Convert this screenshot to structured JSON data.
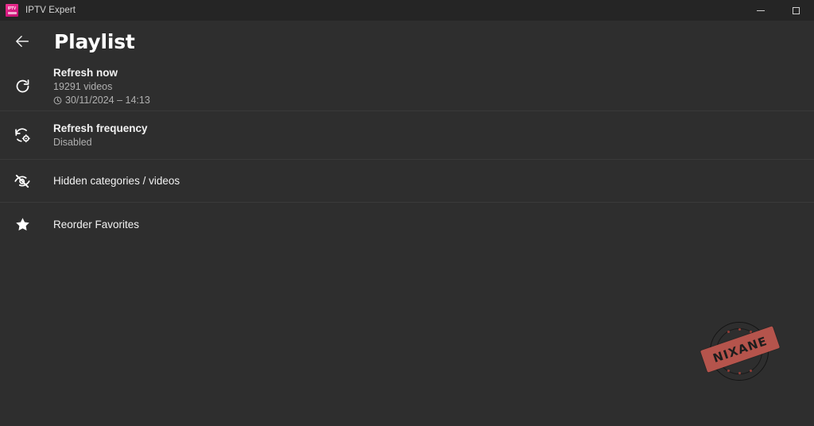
{
  "window": {
    "app_title": "IPTV Expert",
    "app_icon": "iptv-app-icon",
    "icon_glyph": "IPTV",
    "controls": [
      {
        "name": "minimize-button",
        "label": "Minimize"
      },
      {
        "name": "maximize-button",
        "label": "Maximize"
      }
    ]
  },
  "header": {
    "back_icon": "back-arrow-icon",
    "title": "Playlist"
  },
  "list": [
    {
      "icon": "refresh-icon",
      "title": "Refresh now",
      "subtitle": "19291 videos",
      "meta_icon": "clock-icon",
      "meta": "30/11/2024 – 14:13"
    },
    {
      "icon": "refresh-settings-icon",
      "title": "Refresh frequency",
      "subtitle": "Disabled"
    },
    {
      "icon": "eye-off-icon",
      "title": "Hidden categories / videos"
    },
    {
      "icon": "star-icon",
      "title": "Reorder Favorites"
    }
  ],
  "watermark": {
    "text": "NIXANE",
    "band_color": "#b5544c"
  },
  "colors": {
    "titlebar_bg": "#252525",
    "content_bg": "#2e2e2e",
    "divider": "#3a3a3a",
    "accent": "#e01a84",
    "text_primary": "#f2f2f2",
    "text_secondary": "#b0b0b0"
  }
}
